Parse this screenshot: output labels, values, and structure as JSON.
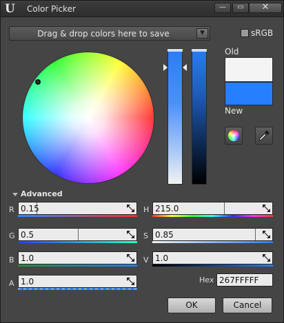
{
  "window": {
    "title": "Color Picker",
    "logo": "U",
    "minimize_glyph": "—",
    "restore_glyph": "▭",
    "close_glyph": "✕"
  },
  "toolbar": {
    "drop_label": "Drag & drop colors here to save",
    "srgb_label": "sRGB",
    "srgb_checked": false
  },
  "preview": {
    "old_label": "Old",
    "new_label": "New",
    "old_color": "#F4F4F4",
    "new_color": "#267FFF"
  },
  "tools": {
    "color_wheel_icon": "color-wheel-icon",
    "eyedropper_icon": "eyedropper-icon"
  },
  "advanced": {
    "label": "Advanced",
    "channels": {
      "r": {
        "label": "R",
        "value": "0.15"
      },
      "g": {
        "label": "G",
        "value": "0.5"
      },
      "b": {
        "label": "B",
        "value": "1.0"
      },
      "a": {
        "label": "A",
        "value": "1.0"
      },
      "h": {
        "label": "H",
        "value": "215.0"
      },
      "s": {
        "label": "S",
        "value": "0.85"
      },
      "v": {
        "label": "V",
        "value": "1.0"
      }
    },
    "hex_label": "Hex",
    "hex_value": "267FFFFF"
  },
  "buttons": {
    "ok": "OK",
    "cancel": "Cancel"
  },
  "colors": {
    "accent": "#2A7CF6",
    "window_bg": "#454545",
    "field_bg": "#EBEBEB"
  }
}
